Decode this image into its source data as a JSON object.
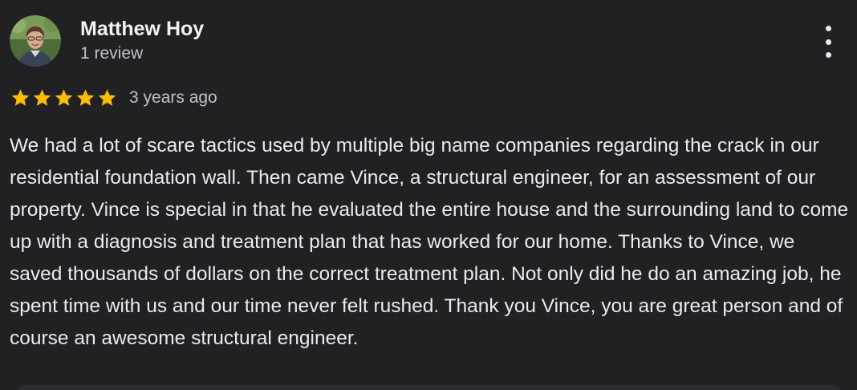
{
  "review": {
    "author_name": "Matthew Hoy",
    "review_count": "1 review",
    "rating": 5,
    "max_rating": 5,
    "date": "3 years ago",
    "text": "We had a lot of scare tactics used by multiple big name companies regarding the crack in our residential foundation wall. Then came Vince, a structural engineer, for an assessment of our property. Vince is special in that he evaluated the entire house and the surrounding land to come up with a diagnosis and treatment plan that has worked for our home. Thanks to Vince, we saved thousands of dollars on the correct treatment plan. Not only did he do an amazing job, he spent time with us and our time never felt rushed. Thank you Vince, you are great person and of course an awesome structural engineer."
  },
  "icons": {
    "star": "star-icon",
    "menu": "more-vert-icon"
  },
  "colors": {
    "background": "#212124",
    "star": "#fbbc04",
    "primary_text": "#e8eaed",
    "secondary_text": "#bdc1c6"
  }
}
